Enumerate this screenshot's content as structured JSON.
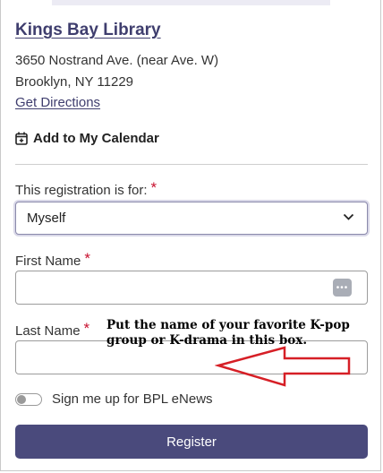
{
  "location": {
    "branch_name": "Kings Bay Library",
    "address_line1": "3650 Nostrand Ave. (near Ave. W)",
    "address_line2": "Brooklyn, NY 11229",
    "directions_link": "Get Directions"
  },
  "calendar": {
    "label": "Add to My Calendar",
    "icon": "calendar-plus-icon"
  },
  "form": {
    "registration_for": {
      "label": "This registration is for:",
      "required_mark": "*",
      "selected_value": "Myself"
    },
    "first_name": {
      "label": "First Name",
      "required_mark": "*",
      "value": ""
    },
    "last_name": {
      "label": "Last Name",
      "required_mark": "*",
      "value": ""
    },
    "enews": {
      "label": "Sign me up for BPL eNews",
      "checked": false
    },
    "submit_label": "Register"
  },
  "annotation": {
    "text_line1": "Put the name of your favorite K-pop",
    "text_line2": "group or K-drama in this box.",
    "arrow_color": "#d61f26"
  },
  "colors": {
    "accent": "#4a4a7c",
    "link": "#3f3e6e",
    "required": "#c8102e"
  }
}
